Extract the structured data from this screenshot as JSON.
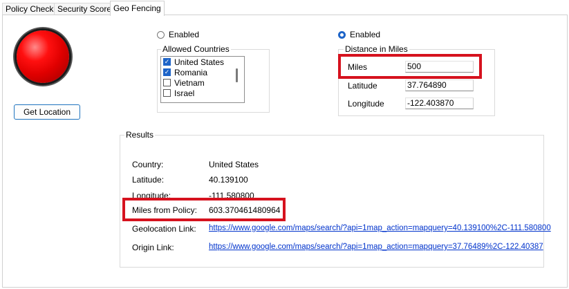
{
  "tabs": [
    {
      "label": "Policy Check"
    },
    {
      "label": "Security Score"
    },
    {
      "label": "Geo Fencing"
    }
  ],
  "status_light": {
    "color": "#e00000"
  },
  "get_location_label": "Get Location",
  "countries_section": {
    "enabled_label": "Enabled",
    "group_title": "Allowed Countries",
    "items": [
      {
        "label": "United States",
        "checked": true
      },
      {
        "label": "Romania",
        "checked": true
      },
      {
        "label": "Vietnam",
        "checked": false
      },
      {
        "label": "Israel",
        "checked": false
      }
    ]
  },
  "distance_section": {
    "enabled_label": "Enabled",
    "group_title": "Distance in Miles",
    "miles_label": "Miles",
    "miles_value": "500",
    "latitude_label": "Latitude",
    "latitude_value": "37.764890",
    "longitude_label": "Longitude",
    "longitude_value": "-122.403870"
  },
  "results": {
    "group_title": "Results",
    "country_label": "Country:",
    "country_value": "United States",
    "latitude_label": "Latitude:",
    "latitude_value": "40.139100",
    "longitude_label": "Longitude:",
    "longitude_value": "-111.580800",
    "miles_label": "Miles from Policy:",
    "miles_value": "603.370461480964",
    "geolocation_label": "Geolocation Link:",
    "geolocation_link": "https://www.google.com/maps/search/?api=1map_action=mapquery=40.139100%2C-111.580800",
    "origin_label": "Origin Link:",
    "origin_link": "https://www.google.com/maps/search/?api=1map_action=mapquery=37.76489%2C-122.40387"
  },
  "colors": {
    "highlight": "#d6121e",
    "accent": "#1e64c8",
    "link": "#0033cc"
  }
}
